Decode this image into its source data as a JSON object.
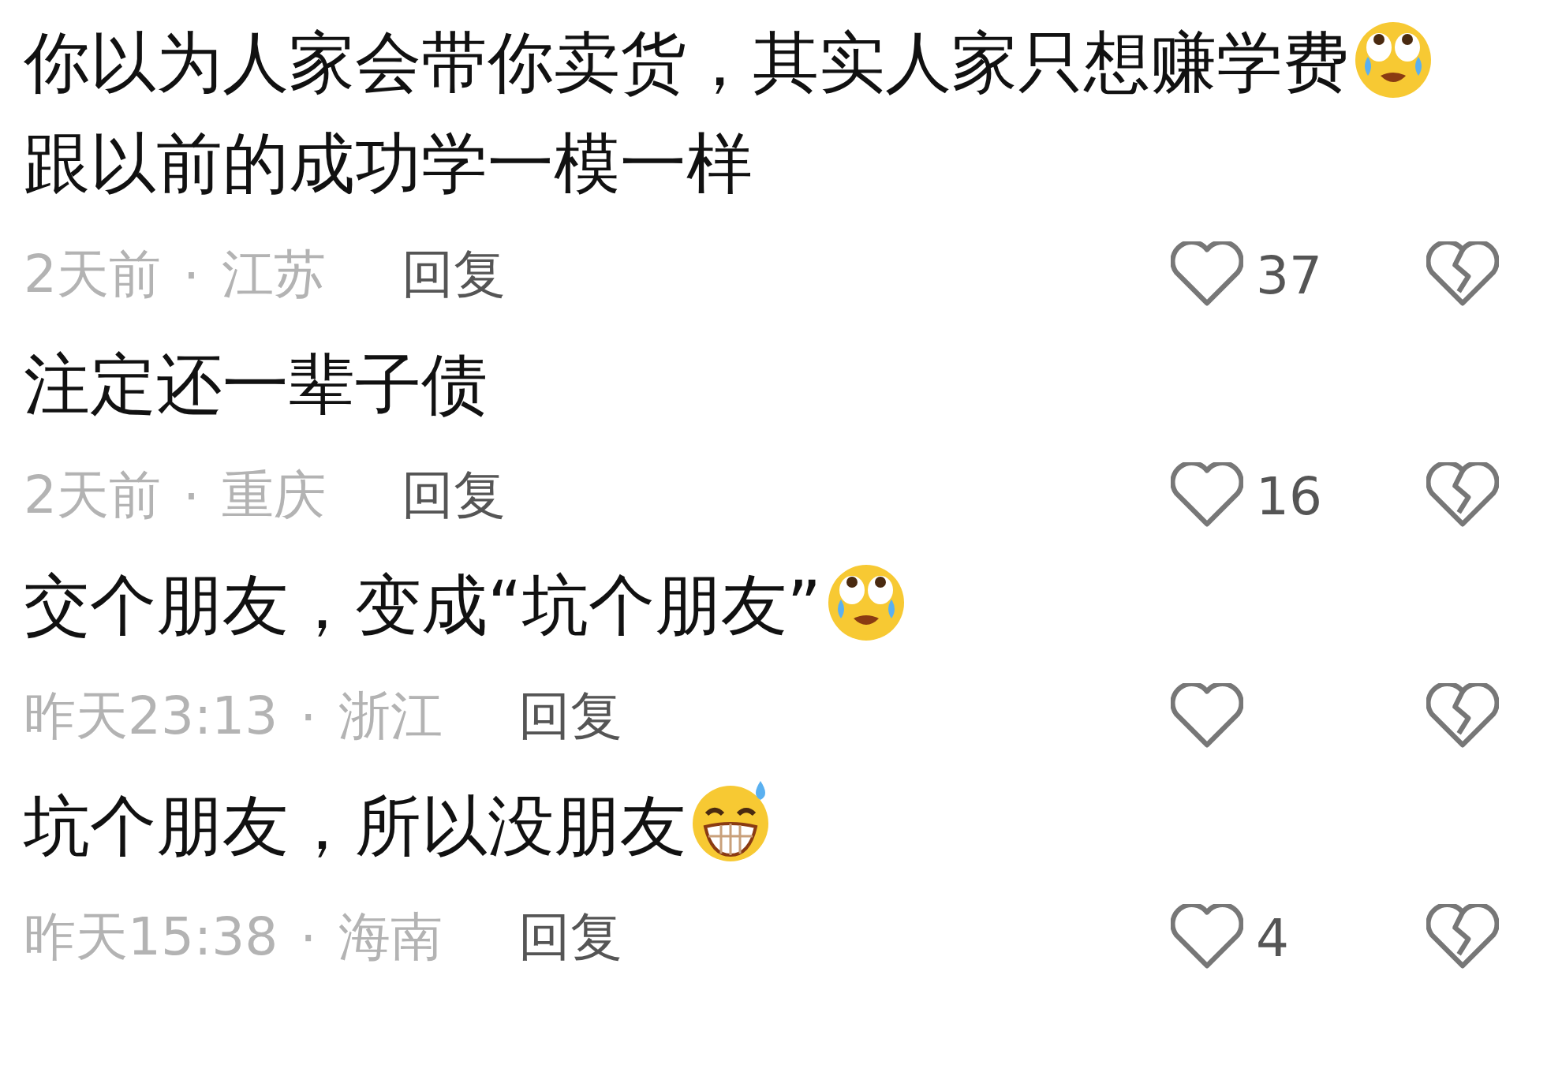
{
  "comments": [
    {
      "segments": [
        {
          "kind": "text",
          "text": "你以为人家会带你卖货，其实人家只想赚学费"
        },
        {
          "kind": "teary"
        },
        {
          "kind": "text",
          "text": "跟以前的成功学一模一样"
        }
      ],
      "time": "2天前",
      "separator": "·",
      "location": "江苏",
      "reply": "回复",
      "likes": "37"
    },
    {
      "segments": [
        {
          "kind": "text",
          "text": "注定还一辈子债"
        }
      ],
      "time": "2天前",
      "separator": "·",
      "location": "重庆",
      "reply": "回复",
      "likes": "16"
    },
    {
      "segments": [
        {
          "kind": "text",
          "text": "交个朋友，变成“坑个朋友”"
        },
        {
          "kind": "teary"
        }
      ],
      "time": "昨天23:13",
      "separator": "·",
      "location": "浙江",
      "reply": "回复"
    },
    {
      "segments": [
        {
          "kind": "text",
          "text": "坑个朋友，所以没朋友"
        },
        {
          "kind": "sweat"
        }
      ],
      "time": "昨天15:38",
      "separator": "·",
      "location": "海南",
      "reply": "回复",
      "likes": "4"
    }
  ]
}
